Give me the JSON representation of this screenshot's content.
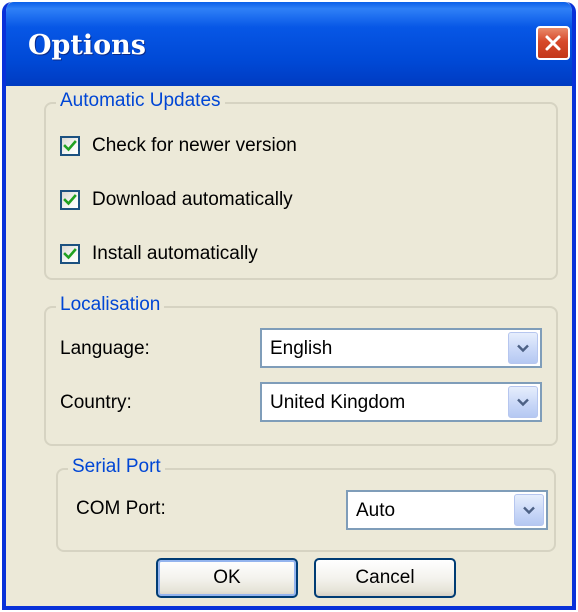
{
  "window": {
    "title": "Options"
  },
  "automatic_updates": {
    "title": "Automatic Updates",
    "items": [
      {
        "label": "Check for newer version",
        "checked": true
      },
      {
        "label": "Download automatically",
        "checked": true
      },
      {
        "label": "Install automatically",
        "checked": true
      }
    ]
  },
  "localisation": {
    "title": "Localisation",
    "language_label": "Language:",
    "language_value": "English",
    "country_label": "Country:",
    "country_value": "United Kingdom"
  },
  "serial_port": {
    "title": "Serial Port",
    "com_port_label": "COM Port:",
    "com_port_value": "Auto"
  },
  "buttons": {
    "ok_label": "OK",
    "cancel_label": "Cancel"
  },
  "colors": {
    "titlebar": "#0054e3",
    "group_title": "#0046d5",
    "window_bg": "#ece9d8",
    "checkmark": "#21a121",
    "close_button": "#d7492a"
  },
  "icons": {
    "close": "close-icon",
    "check": "checkmark-icon",
    "dropdown": "chevron-down-icon"
  }
}
